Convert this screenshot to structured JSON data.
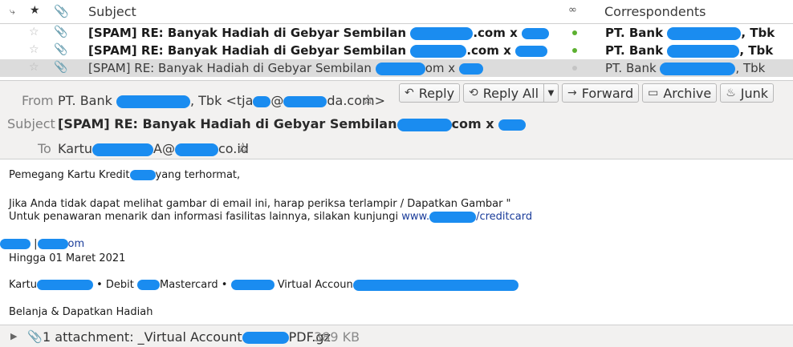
{
  "list": {
    "columns": {
      "subject": "Subject",
      "correspondents": "Correspondents"
    },
    "icons": {
      "thread": "thread-icon",
      "star": "star-icon",
      "attachment": "paperclip-icon",
      "read": "read-status-icon"
    },
    "rows": [
      {
        "subject_a": "[SPAM] RE: Banyak Hadiah di Gebyar Sembilan",
        "subject_b": ".com x",
        "corr_a": "PT. Bank",
        "corr_b": ", Tbk",
        "status": "green"
      },
      {
        "subject_a": "[SPAM] RE: Banyak Hadiah di Gebyar Sembilan",
        "subject_b": ".com x",
        "corr_a": "PT. Bank",
        "corr_b": ", Tbk",
        "status": "green"
      },
      {
        "subject_a": "[SPAM] RE: Banyak Hadiah di Gebyar Sembilan",
        "subject_b": "om x",
        "corr_a": "PT. Bank",
        "corr_b": ", Tbk",
        "status": "grey"
      }
    ]
  },
  "header": {
    "from_label": "From",
    "from_value_a": "PT. Bank",
    "from_value_b": ", Tbk <tja",
    "from_value_c": "@",
    "from_value_d": "da.com>",
    "subject_label": "Subject",
    "subject_value_a": "[SPAM] RE: Banyak Hadiah di Gebyar Sembilan",
    "subject_value_b": "com x",
    "to_label": "To",
    "to_value_a": "Kartu",
    "to_value_b": "A@",
    "to_value_c": "co.id",
    "star_glyph": "☆"
  },
  "toolbar": {
    "reply": "Reply",
    "reply_all": "Reply All",
    "forward": "Forward",
    "archive": "Archive",
    "junk": "Junk"
  },
  "body": {
    "greeting_a": "Pemegang Kartu Kredit",
    "greeting_b": "yang terhormat,",
    "line1": "Jika Anda tidak dapat melihat gambar di email ini, harap periksa terlampir / Dapatkan Gambar \"",
    "line2_a": "Untuk penawaran menarik dan informasi fasilitas lainnya, silakan kunjungi",
    "link_a": "www.",
    "link_b": "/creditcard",
    "brand_sep": "|",
    "brand_tail": "om",
    "until": "Hingga 01 Maret 2021",
    "kartu": "Kartu",
    "debit": "• Debit",
    "mastercard": "Mastercard •",
    "virtual": "Virtual Accoun",
    "belanja": "Belanja & Dapatkan Hadiah"
  },
  "attachment": {
    "label_a": "1 attachment: _Virtual Account",
    "label_b": "PDF.gz",
    "size": "389 KB"
  }
}
